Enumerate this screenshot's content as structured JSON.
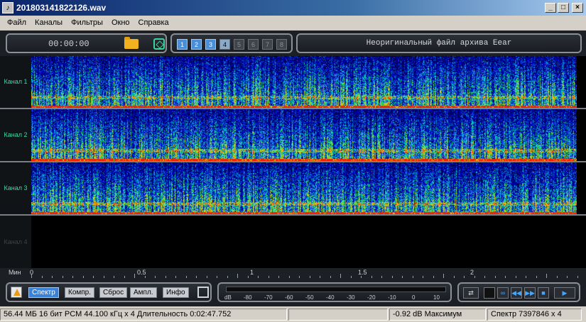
{
  "window": {
    "title": "201803141822126.wav"
  },
  "menu": [
    "Файл",
    "Каналы",
    "Фильтры",
    "Окно",
    "Справка"
  ],
  "toolbar": {
    "time": "00:00:00",
    "channel_buttons": [
      "1",
      "2",
      "3",
      "4",
      "5",
      "6",
      "7",
      "8"
    ],
    "archive_status": "Неоригинальный файл архива Eear"
  },
  "channels": [
    "Канал 1",
    "Канал 2",
    "Канал 3",
    "Канал 4"
  ],
  "timeline": {
    "unit_label": "Мин",
    "ticks": [
      "0",
      "0.5",
      "1",
      "1.5",
      "2"
    ]
  },
  "controls": {
    "buttons": [
      "Спектр",
      "Компр.",
      "Сброс",
      "Ампл.",
      "Инфо"
    ],
    "meter_unit": "dB",
    "meter_ticks": [
      "-80",
      "-70",
      "-60",
      "-50",
      "-40",
      "-30",
      "-20",
      "-10",
      "0",
      "10"
    ]
  },
  "status": {
    "format": "56.44 МБ 16 бит PCM 44.100 кГц x 4  Длительность 0:02:47.752",
    "empty": "",
    "level": "-0.92 dB Максимум",
    "spectrum": "Спектр 7397846 x 4"
  },
  "colors": {
    "accent": "#3a82d8",
    "channel_label": "#3fd8a0",
    "spectro_low": "#00005a",
    "spectro_high": "#ff3000"
  }
}
